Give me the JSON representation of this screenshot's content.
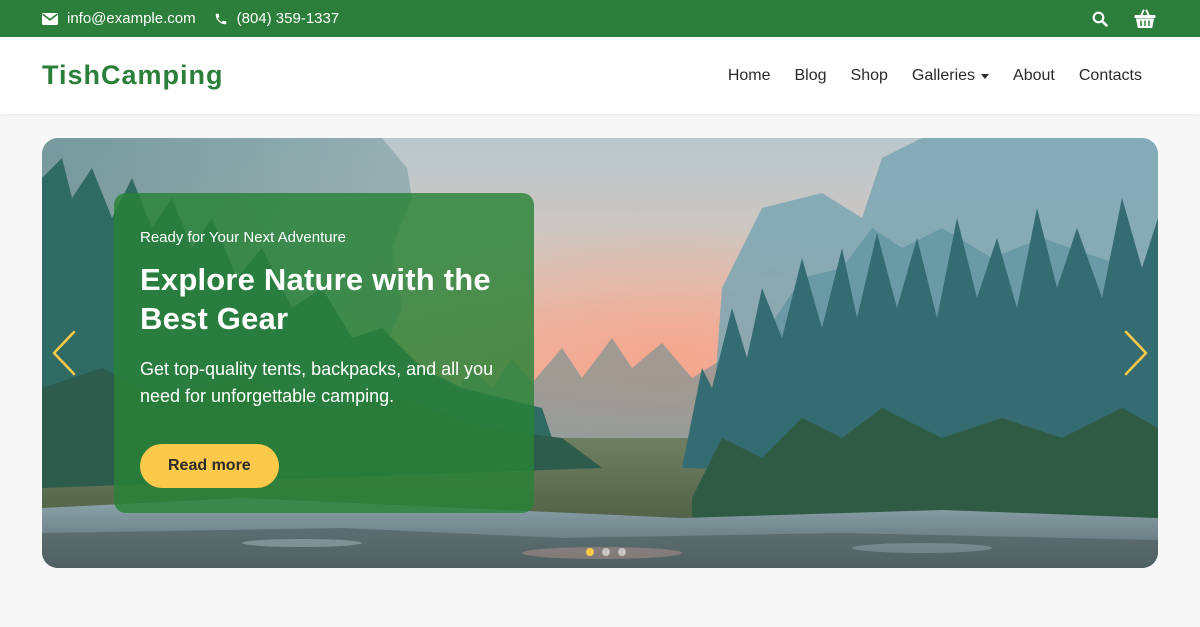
{
  "topbar": {
    "email": "info@example.com",
    "phone": "(804) 359-1337",
    "icons": [
      "envelope-icon",
      "phone-icon",
      "search-icon",
      "basket-icon"
    ]
  },
  "brand": "TishCamping",
  "nav": {
    "items": [
      "Home",
      "Blog",
      "Shop",
      "Galleries",
      "About",
      "Contacts"
    ]
  },
  "hero": {
    "eyebrow": "Ready for Your Next Adventure",
    "title": "Explore Nature with the Best Gear",
    "description": "Get top-quality tents, backpacks, and all you need for unforgettable camping.",
    "cta": "Read more",
    "slide_count": 3,
    "active_slide": 1
  },
  "colors": {
    "primary": "#2b7f3b",
    "accent": "#fdc94a",
    "background": "#f7f7f7"
  }
}
